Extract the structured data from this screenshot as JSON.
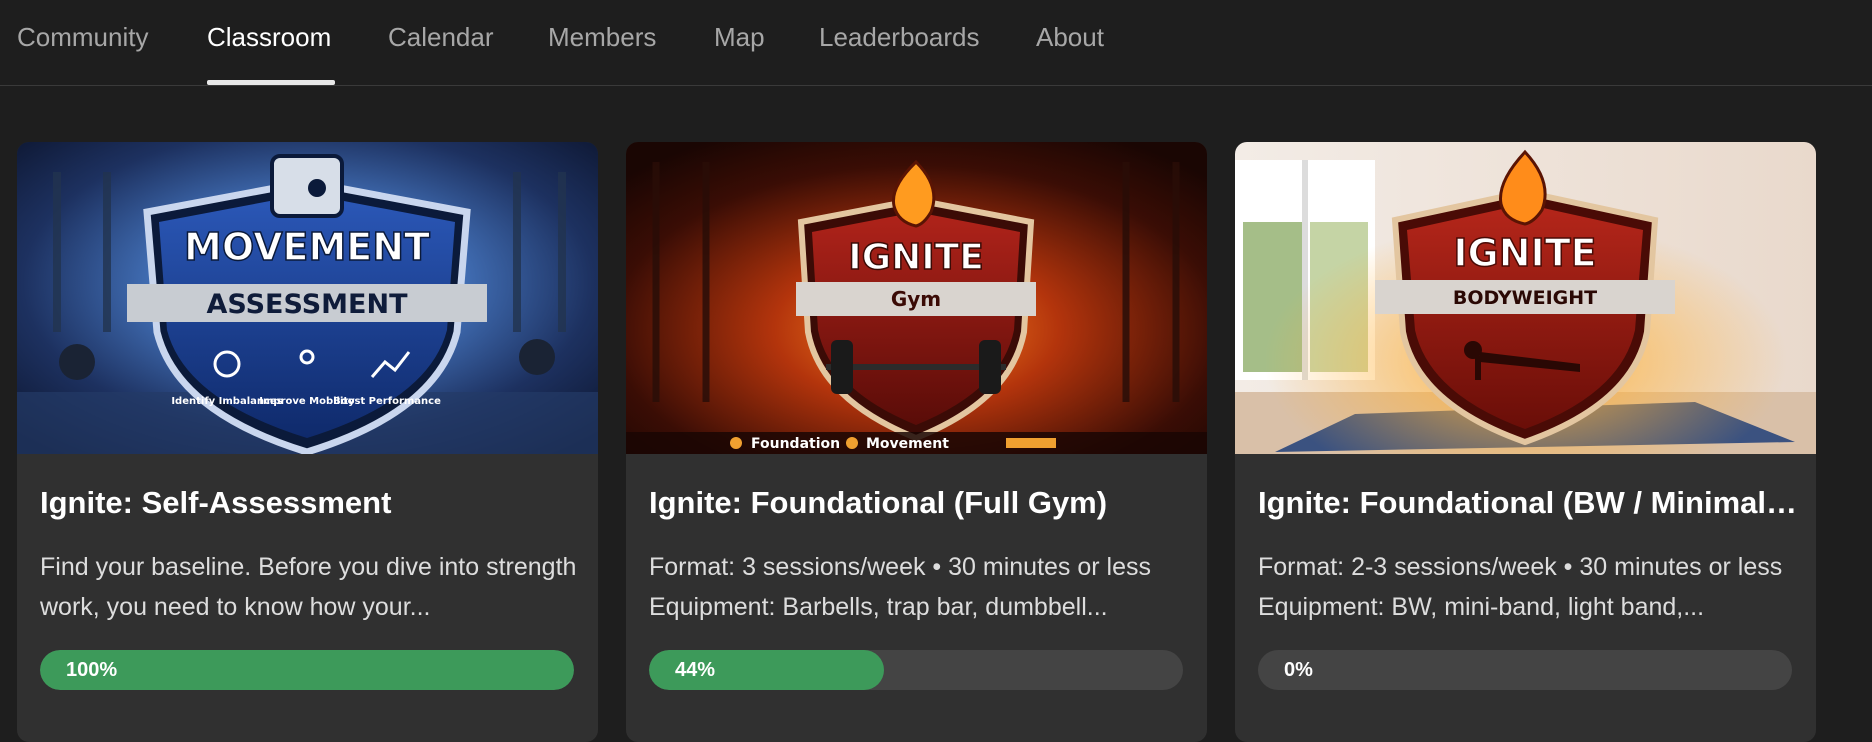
{
  "nav": {
    "tabs": [
      {
        "label": "Community"
      },
      {
        "label": "Classroom"
      },
      {
        "label": "Calendar"
      },
      {
        "label": "Members"
      },
      {
        "label": "Map"
      },
      {
        "label": "Leaderboards"
      },
      {
        "label": "About"
      }
    ],
    "active": "Classroom"
  },
  "colors": {
    "background": "#1e1e1e",
    "card": "#303030",
    "progress_fill": "#3d9a5a",
    "progress_track": "#444444"
  },
  "cards": [
    {
      "title": "Ignite: Self-Assessment",
      "description": "Find your baseline. Before you dive into strength work, you need to know how your...",
      "progress_label": "100%",
      "progress": 100,
      "image": {
        "headline": "MOVEMENT",
        "subline": "ASSESSMENT",
        "badges": [
          "Identify Imbalances",
          "Improve Mobility",
          "Boost Performance"
        ]
      }
    },
    {
      "title": "Ignite: Foundational (Full Gym)",
      "description": "Format: 3 sessions/week • 30 minutes or less Equipment: Barbells, trap bar, dumbbell...",
      "progress_label": "44%",
      "progress": 44,
      "image": {
        "headline": "IGNITE",
        "subline": "Gym",
        "footer": [
          "Foundation",
          "Movement"
        ]
      }
    },
    {
      "title": "Ignite: Foundational (BW / Minimal Equipment)",
      "description": "Format: 2-3 sessions/week • 30 minutes or less Equipment: BW, mini-band, light band,...",
      "progress_label": "0%",
      "progress": 0,
      "image": {
        "headline": "IGNITE",
        "subline": "BODYWEIGHT"
      }
    }
  ]
}
